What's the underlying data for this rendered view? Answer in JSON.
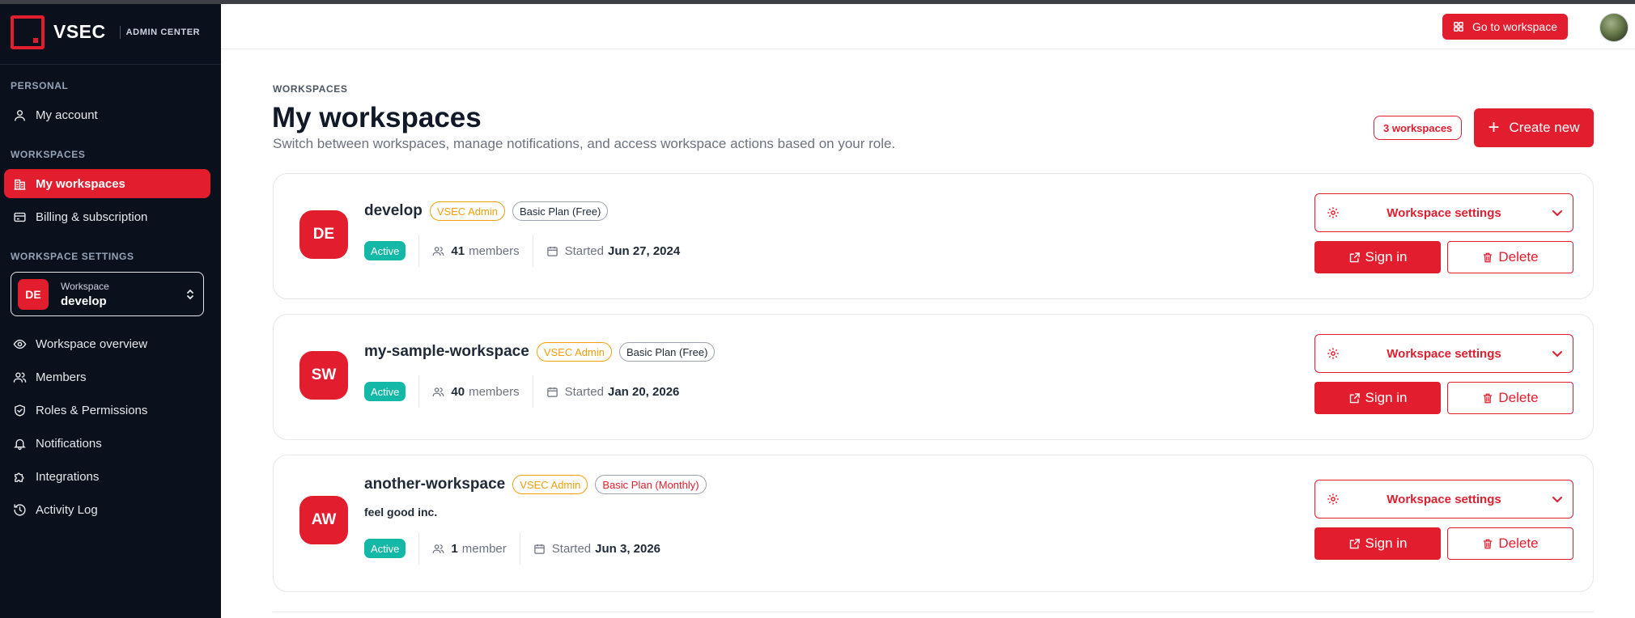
{
  "brand": {
    "name": "VSEC",
    "subtitle": "ADMIN CENTER"
  },
  "sidebar": {
    "personal_label": "PERSONAL",
    "my_account": "My account",
    "workspaces_label": "WORKSPACES",
    "my_workspaces": "My workspaces",
    "billing": "Billing & subscription",
    "workspace_settings_label": "WORKSPACE SETTINGS",
    "switcher": {
      "initials": "DE",
      "caption": "Workspace",
      "name": "develop"
    },
    "items": [
      "Workspace overview",
      "Members",
      "Roles & Permissions",
      "Notifications",
      "Integrations",
      "Activity Log"
    ]
  },
  "topbar": {
    "goto_label": "Go to workspace"
  },
  "header": {
    "crumb": "WORKSPACES",
    "title": "My workspaces",
    "subtitle": "Switch between workspaces, manage notifications, and access workspace actions based on your role.",
    "count": "3 workspaces",
    "create_label": "Create new"
  },
  "actions": {
    "settings": "Workspace settings",
    "signin": "Sign in",
    "delete": "Delete"
  },
  "workspaces": [
    {
      "initials": "DE",
      "name": "develop",
      "role": "VSEC Admin",
      "plan": "Basic Plan (Free)",
      "description": "",
      "status": "Active",
      "members_count": "41",
      "members_word": "members",
      "started_label": "Started",
      "started": "Jun 27, 2024"
    },
    {
      "initials": "SW",
      "name": "my-sample-workspace",
      "role": "VSEC Admin",
      "plan": "Basic Plan (Free)",
      "description": "",
      "status": "Active",
      "members_count": "40",
      "members_word": "members",
      "started_label": "Started",
      "started": "Jan 20, 2026"
    },
    {
      "initials": "AW",
      "name": "another-workspace",
      "role": "VSEC Admin",
      "plan": "Basic Plan (Monthly)",
      "description": "feel good inc.",
      "status": "Active",
      "members_count": "1",
      "members_word": "member",
      "started_label": "Started",
      "started": "Jun 3, 2026"
    }
  ],
  "colors": {
    "accent": "#e11d2e",
    "sidebar_bg": "#0b111c",
    "status": "#14b8a6",
    "role_badge": "#f59e0b"
  }
}
